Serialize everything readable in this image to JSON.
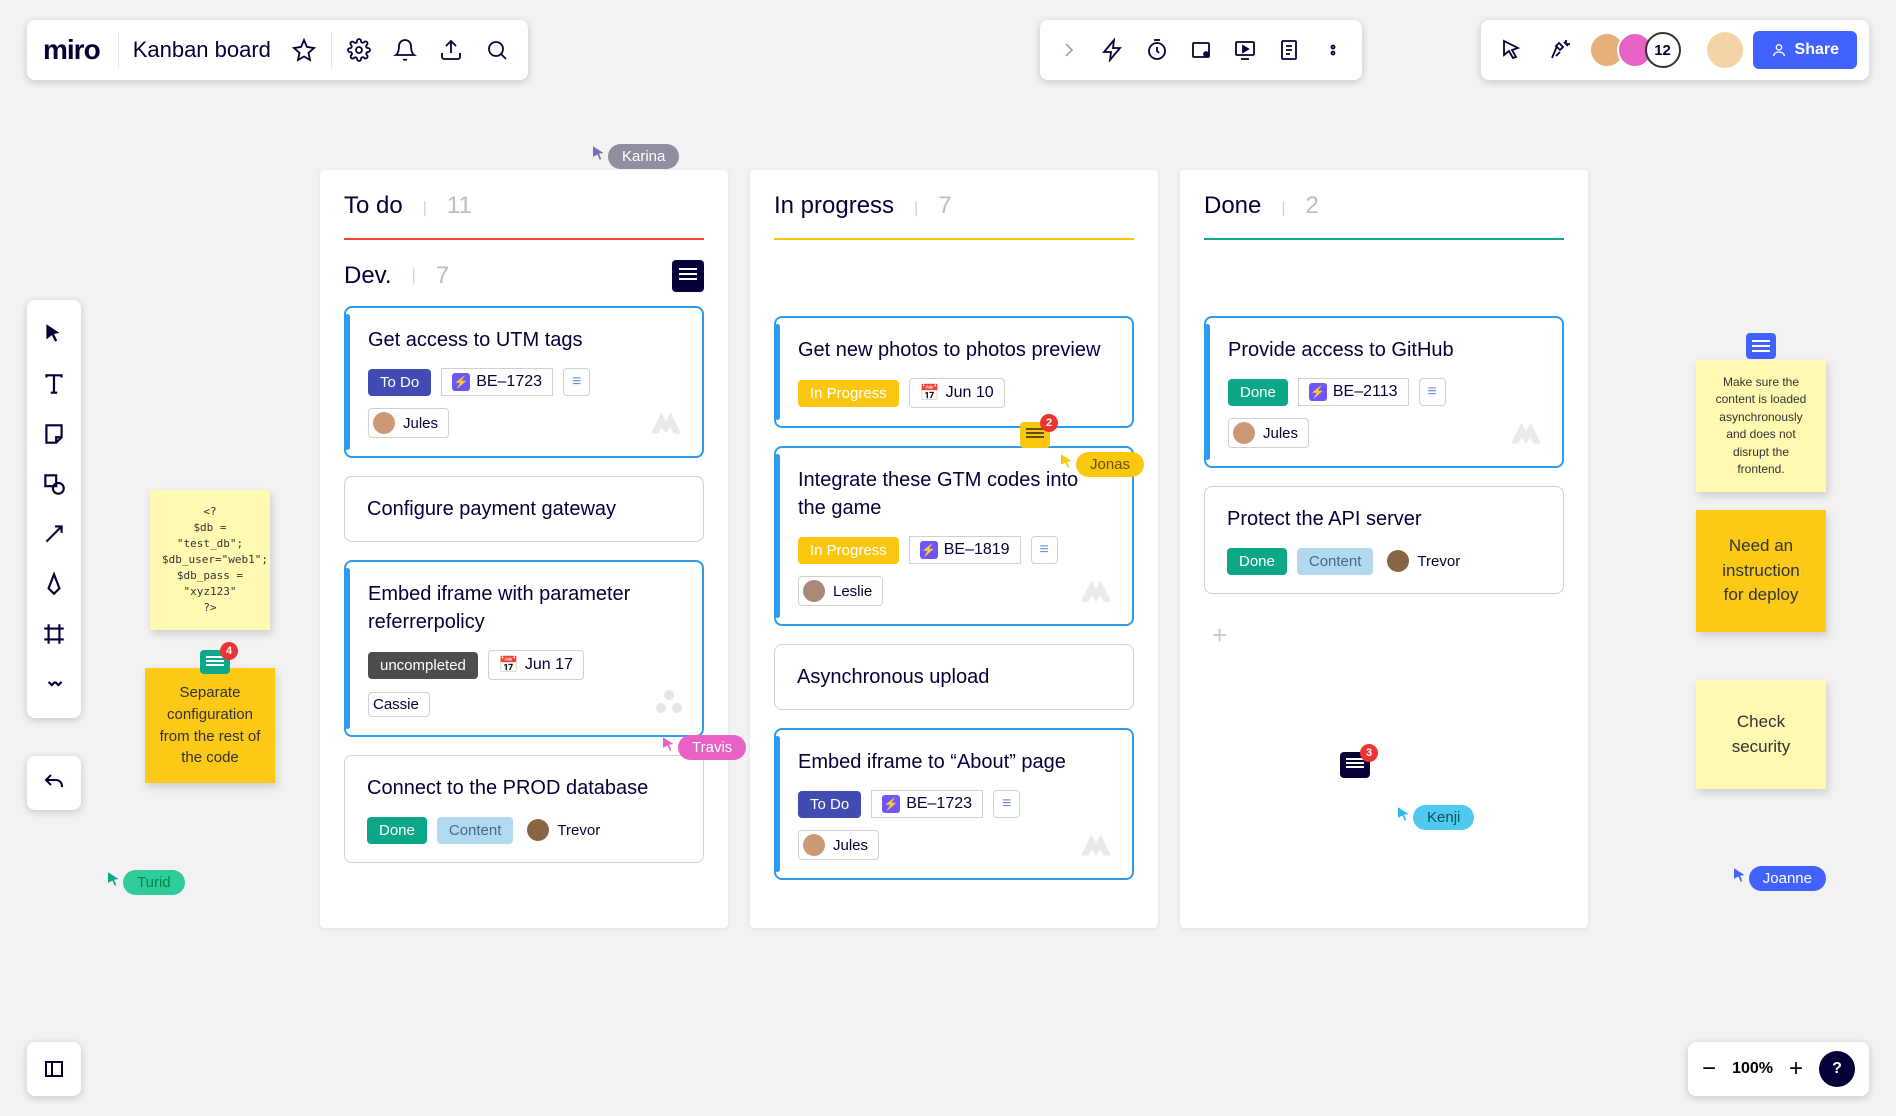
{
  "header": {
    "logo": "miro",
    "board_name": "Kanban board",
    "avatar_count": "12",
    "share_label": "Share"
  },
  "zoom": {
    "level": "100%"
  },
  "help": "?",
  "columns": {
    "todo": {
      "title": "To do",
      "count": "11",
      "color": "#f24726"
    },
    "inprog": {
      "title": "In progress",
      "count": "7",
      "color": "#fac710"
    },
    "done": {
      "title": "Done",
      "count": "2",
      "color": "#0ca789"
    }
  },
  "subheader": {
    "title": "Dev.",
    "count": "7"
  },
  "cards": {
    "todo": [
      {
        "title": "Get access to UTM tags",
        "status": "To Do",
        "code": "BE–1723",
        "assignee": "Jules"
      },
      {
        "title": "Configure payment gateway"
      },
      {
        "title": "Embed iframe with parameter referrerpolicy",
        "status": "uncompleted",
        "date": "Jun 17",
        "assignee": "Cassie"
      },
      {
        "title": "Connect to the PROD database",
        "status": "Done",
        "extra": "Content",
        "assignee": "Trevor"
      }
    ],
    "inprog": [
      {
        "title": "Get new photos to photos preview",
        "status": "In Progress",
        "date": "Jun 10"
      },
      {
        "title": "Integrate these GTM codes into the game",
        "status": "In Progress",
        "code": "BE–1819",
        "assignee": "Leslie"
      },
      {
        "title": "Asynchronous upload"
      },
      {
        "title": "Embed iframe to “About” page",
        "status": "To Do",
        "code": "BE–1723",
        "assignee": "Jules"
      }
    ],
    "done": [
      {
        "title": "Provide access to GitHub",
        "status": "Done",
        "code": "BE–2113",
        "assignee": "Jules"
      },
      {
        "title": "Protect the API server",
        "status": "Done",
        "extra": "Content",
        "assignee": "Trevor"
      }
    ]
  },
  "stickies": {
    "code": "<?\n$db = \"test_db\";\n$db_user=\"web1\";\n$db_pass = \"xyz123\"\n?>",
    "separate": "Separate configuration from the rest of the code",
    "async": "Make sure the content is loaded asynchronously and does not disrupt the frontend.",
    "deploy": "Need an instruction for deploy",
    "security": "Check security"
  },
  "cursors": {
    "karina": "Karina",
    "travis": "Travis",
    "turid": "Turid",
    "jonas": "Jonas",
    "kenji": "Kenji",
    "joanne": "Joanne"
  },
  "badges": {
    "sticky_sep": "4",
    "gold_chip": "2",
    "black_chip": "3"
  }
}
